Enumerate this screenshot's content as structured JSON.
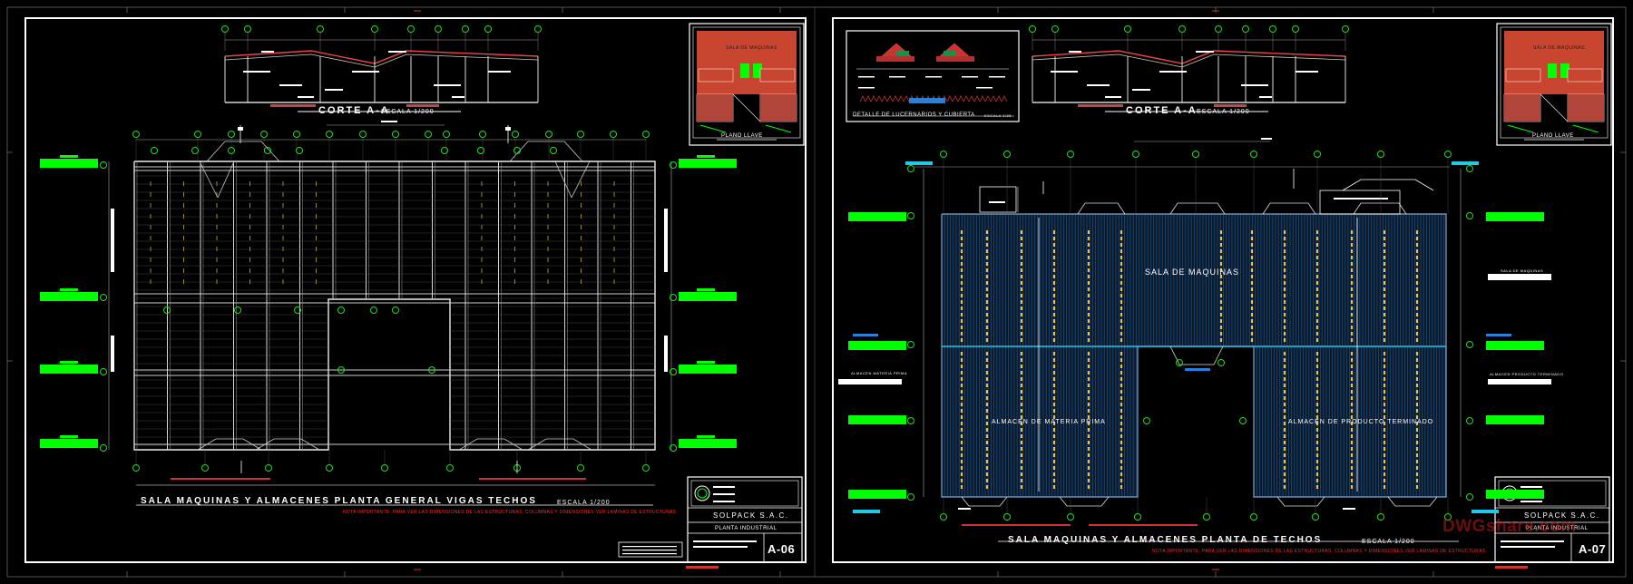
{
  "left_sheet": {
    "section_title": "CORTE A-A",
    "section_scale": "ESCALA 1/200",
    "key_plan_label": "PLANO LLAVE",
    "key_plan_room": "SALA DE MAQUINAS",
    "plan_title": "SALA MAQUINAS Y ALMACENES PLANTA GENERAL VIGAS TECHOS",
    "plan_scale": "ESCALA 1/200",
    "note": "NOTA IMPORTANTE: PARA VER LAS DIMENSIONES DE LAS ESTRUCTURAS, COLUMNAS Y DIMENSIONES VER LAMINAS DE ESTRUCTURAS",
    "company": "SOLPACK S.A.C.",
    "project": "PLANTA INDUSTRIAL",
    "sheet_number": "A-06"
  },
  "right_sheet": {
    "detail_title": "DETALLE DE LUCERNARIOS Y CUBIERTA",
    "detail_scale": "ESCALA 1/25",
    "section_title": "CORTE A-A",
    "section_scale": "ESCALA 1/200",
    "key_plan_label": "PLANO LLAVE",
    "key_plan_room": "SALA DE MAQUINAS",
    "room_machines": "SALA DE MAQUINAS",
    "room_raw": "ALMACEN DE MATERIA PRIMA",
    "room_finished": "ALMACEN DE PRODUCTO TERMINADO",
    "side_label_machines": "SALA DE MAQUINAS",
    "side_label_raw": "ALMACEN MATERIA PRIMA",
    "side_label_finished": "ALMACEN PRODUCTO TERMINADO",
    "plan_title": "SALA MAQUINAS Y ALMACENES PLANTA DE TECHOS",
    "plan_scale": "ESCALA 1/200",
    "note": "NOTA IMPORTANTE: PARA VER LAS DIMENSIONES DE LAS ESTRUCTURAS, COLUMNAS Y DIMENSIONES VER LAMINAS DE ESTRUCTURAS",
    "company": "SOLPACK S.A.C.",
    "project": "PLANTA INDUSTRIAL",
    "sheet_number": "A-07"
  },
  "watermark": "DWGshare.com",
  "colors": {
    "background": "#000000",
    "frame": "#ffffff",
    "grid_bubble": "#22dd22",
    "level_tag": "#00ff00",
    "roof_hatch": "#1b4a7a",
    "skylight": "#e8c24a",
    "note_red": "#ff2a2a",
    "cyan": "#22c8e8"
  }
}
